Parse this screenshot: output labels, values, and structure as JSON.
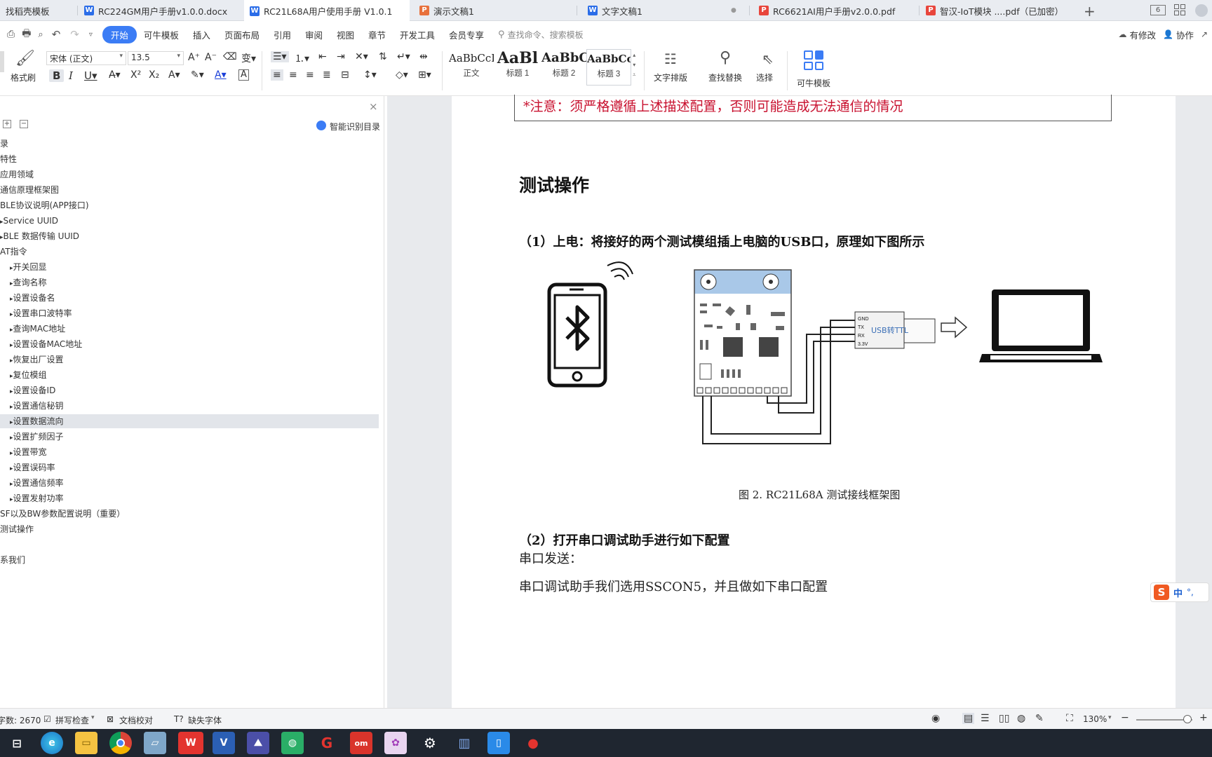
{
  "tabs": [
    {
      "label": "找稻壳模板",
      "icon": "daoke-icon",
      "color": "#e8453c"
    },
    {
      "label": "RC224GM用户手册v1.0.0.docx",
      "icon": "word-icon",
      "color": "#2b6de8"
    },
    {
      "label": "RC21L68A用户使用手册 V1.0.1",
      "icon": "word-icon",
      "color": "#2b6de8"
    },
    {
      "label": "演示文稿1",
      "icon": "ppt-icon",
      "color": "#e8713c"
    },
    {
      "label": "文字文稿1",
      "icon": "word-icon",
      "color": "#2b6de8"
    },
    {
      "label": "RC6621AI用户手册v2.0.0.pdf",
      "icon": "pdf-icon",
      "color": "#e8453c"
    },
    {
      "label": "智汉-IoT模块 ....pdf（已加密）",
      "icon": "pdf-icon",
      "color": "#e8453c"
    }
  ],
  "window": {
    "tab_count": "6"
  },
  "menu": {
    "items": [
      "开始",
      "可牛模板",
      "插入",
      "页面布局",
      "引用",
      "审阅",
      "视图",
      "章节",
      "开发工具",
      "会员专享"
    ],
    "search_placeholder": "查找命令、搜索模板",
    "right": [
      "有修改",
      "协作"
    ]
  },
  "ribbon": {
    "format_painter": "格式刷",
    "font_name": "宋体 (正文)",
    "font_size": "13.5",
    "styles": [
      {
        "sample": "AaBbCcI",
        "label": "正文"
      },
      {
        "sample": "AaBl",
        "label": "标题 1"
      },
      {
        "sample": "AaBbC",
        "label": "标题 2"
      },
      {
        "sample": "AaBbCcI",
        "label": "标题 3"
      }
    ],
    "text_layout": "文字排版",
    "find_replace": "查找替换",
    "select": "选择",
    "template": "可牛模板"
  },
  "sidebar": {
    "smart_toc": "智能识别目录",
    "items": [
      {
        "text": "录",
        "indent": 0
      },
      {
        "text": "特性",
        "indent": 0
      },
      {
        "text": "应用领域",
        "indent": 0
      },
      {
        "text": "通信原理框架图",
        "indent": 0
      },
      {
        "text": "BLE协议说明(APP接口)",
        "indent": 0
      },
      {
        "text": "Service UUID",
        "indent": 1
      },
      {
        "text": "BLE 数据传输 UUID",
        "indent": 1
      },
      {
        "text": "AT指令",
        "indent": 0
      },
      {
        "text": "开关回显",
        "indent": 2
      },
      {
        "text": "查询名称",
        "indent": 2
      },
      {
        "text": "设置设备名",
        "indent": 2
      },
      {
        "text": "设置串口波特率",
        "indent": 2
      },
      {
        "text": "查询MAC地址",
        "indent": 2
      },
      {
        "text": "设置设备MAC地址",
        "indent": 2
      },
      {
        "text": "恢复出厂设置",
        "indent": 2
      },
      {
        "text": "复位模组",
        "indent": 2
      },
      {
        "text": "设置设备ID",
        "indent": 2
      },
      {
        "text": "设置通信秘钥",
        "indent": 2
      },
      {
        "text": "设置数据流向",
        "indent": 2
      },
      {
        "text": "设置扩频因子",
        "indent": 2
      },
      {
        "text": "设置带宽",
        "indent": 2
      },
      {
        "text": "设置误码率",
        "indent": 2
      },
      {
        "text": "设置通信频率",
        "indent": 2
      },
      {
        "text": "设置发射功率",
        "indent": 2
      },
      {
        "text": "SF以及BW参数配置说明（重要）",
        "indent": 0
      },
      {
        "text": "测试操作",
        "indent": 0
      },
      {
        "text": "",
        "indent": 0
      },
      {
        "text": "系我们",
        "indent": 0
      }
    ],
    "highlighted_index": 18
  },
  "document": {
    "notice": "*注意：须严格遵循上述描述配置，否则可能造成无法通信的情况",
    "heading": "测试操作",
    "step1": "（1）上电：将接好的两个测试模组插上电脑的USB口，原理如下图所示",
    "figure_caption": "图 2. RC21L68A 测试接线框架图",
    "figure_labels": {
      "usb_ttl": "USB转TTL",
      "pins": [
        "GND",
        "TX",
        "RX",
        "3.3V"
      ]
    },
    "step2": "（2）打开串口调试助手进行如下配置",
    "para1": "串口发送：",
    "para2": "串口调试助手我们选用SSCON5，并且做如下串口配置"
  },
  "ime": {
    "label": "中"
  },
  "status": {
    "word_count": "字数: 2670",
    "spell_check": "拼写检查",
    "doc_check": "文档校对",
    "missing_fonts": "缺失字体",
    "zoom": "130%"
  },
  "colors": {
    "accent": "#3b7cf5",
    "notice_red": "#c8102e",
    "highlight": "#e2e5ea",
    "blue_module": "#a9c8e8"
  }
}
